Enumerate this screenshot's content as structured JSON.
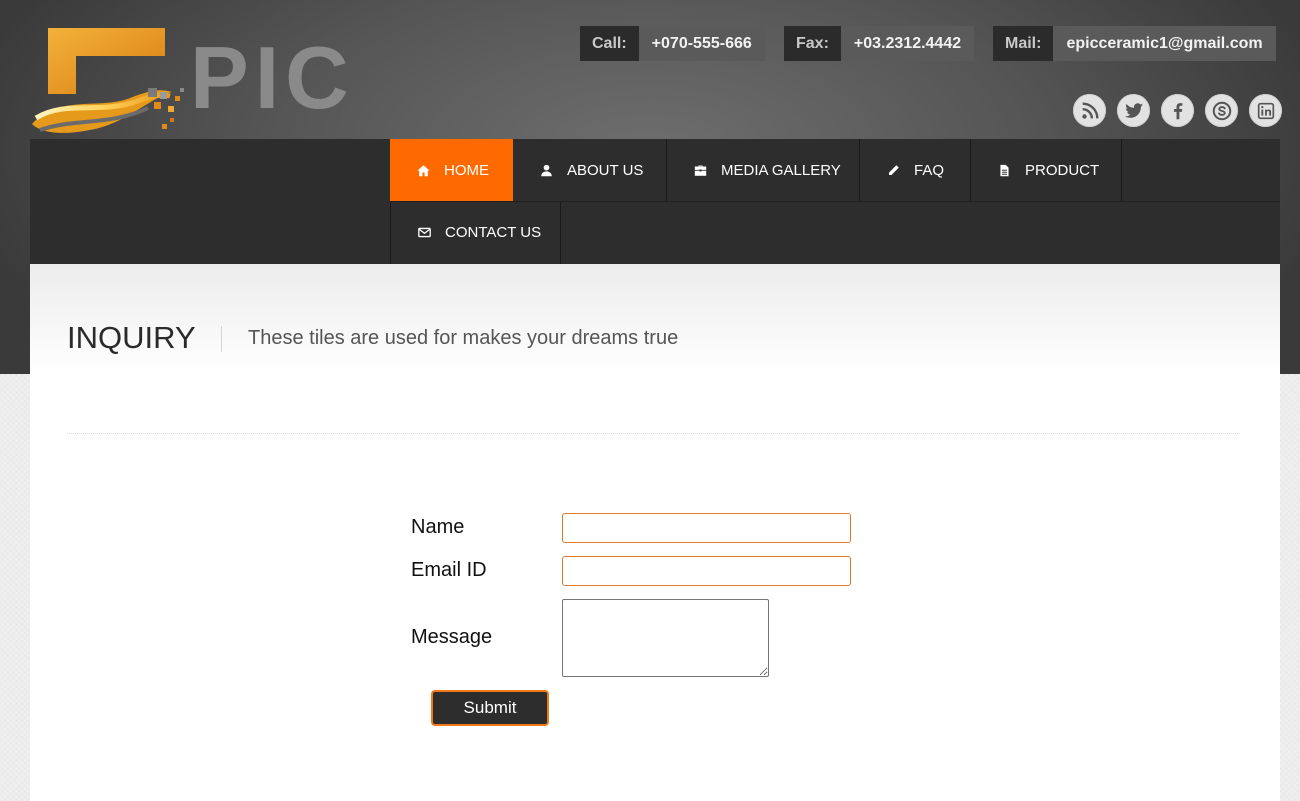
{
  "brand": {
    "logo_text": "PIC",
    "logo_alt": "EPIC",
    "accent_color": "#ff6a00"
  },
  "contact": {
    "call": {
      "label": "Call:",
      "value": "+070-555-666"
    },
    "fax": {
      "label": "Fax:",
      "value": "+03.2312.4442"
    },
    "mail": {
      "label": "Mail:",
      "value": "epicceramic1@gmail.com"
    }
  },
  "socials": [
    {
      "name": "rss-icon"
    },
    {
      "name": "twitter-icon"
    },
    {
      "name": "facebook-icon"
    },
    {
      "name": "skype-icon"
    },
    {
      "name": "linkedin-icon"
    }
  ],
  "nav": {
    "items": [
      {
        "label": "HOME",
        "icon": "home-icon",
        "active": true
      },
      {
        "label": "ABOUT US",
        "icon": "user-icon",
        "active": false
      },
      {
        "label": "MEDIA GALLERY",
        "icon": "briefcase-icon",
        "active": false
      },
      {
        "label": "FAQ",
        "icon": "pencil-icon",
        "active": false
      },
      {
        "label": "PRODUCT",
        "icon": "document-icon",
        "active": false
      },
      {
        "label": "CONTACT US",
        "icon": "envelope-icon",
        "active": false
      }
    ]
  },
  "page": {
    "title": "INQUIRY",
    "subtitle": "These tiles are used for makes your dreams true"
  },
  "form": {
    "name_label": "Name",
    "name_value": "",
    "email_label": "Email ID",
    "email_value": "",
    "message_label": "Message",
    "message_value": "",
    "submit_label": "Submit"
  }
}
